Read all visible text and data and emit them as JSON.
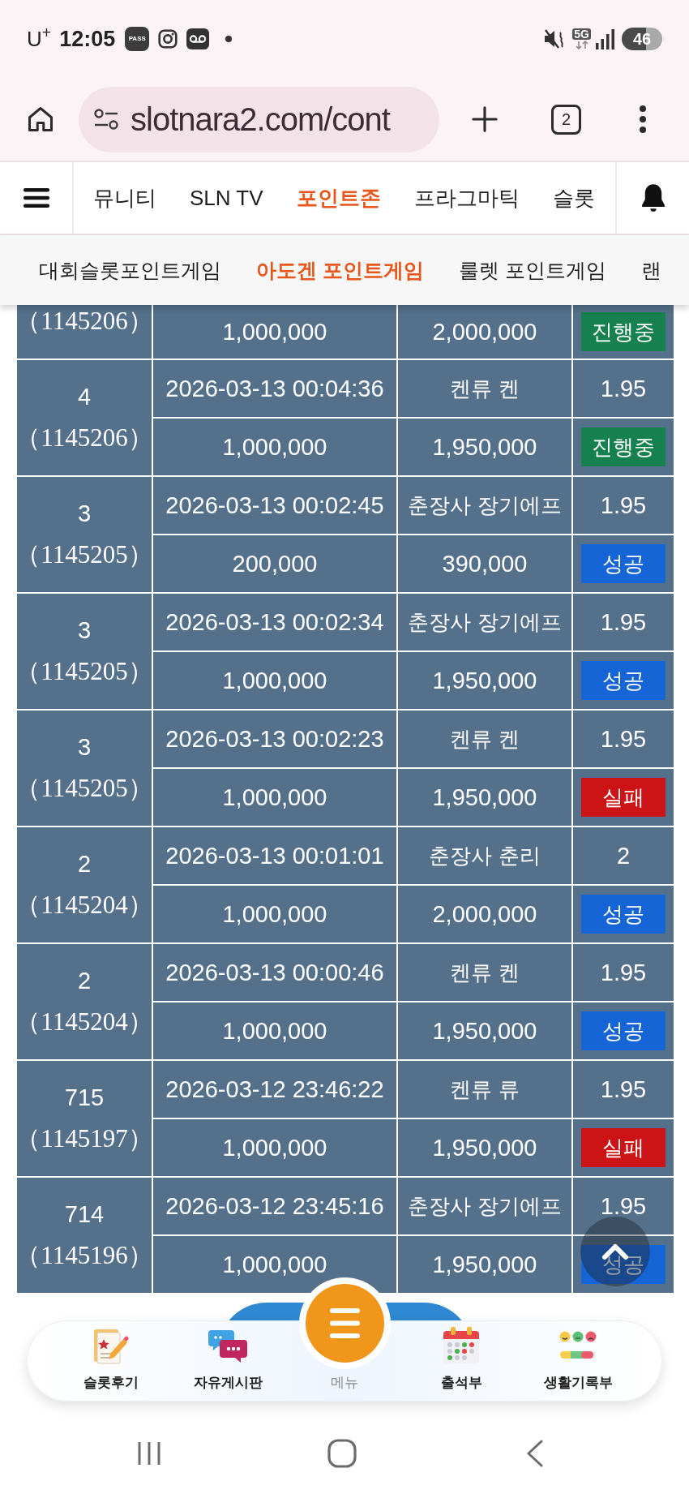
{
  "status_bar": {
    "carrier": "U$^{+}$",
    "time": "12:05",
    "app_badge": "PASS",
    "network": "5G",
    "battery": "46"
  },
  "browser": {
    "url": "slotnara2.com/cont",
    "tab_count": "2"
  },
  "main_nav": [
    {
      "label": "뮤니티",
      "selected": false
    },
    {
      "label": "SLN TV",
      "selected": false
    },
    {
      "label": "포인트존",
      "selected": true
    },
    {
      "label": "프라그마틱",
      "selected": false
    },
    {
      "label": "슬롯",
      "selected": false
    }
  ],
  "sub_nav": [
    {
      "label": "대회슬롯포인트게임",
      "selected": false
    },
    {
      "label": "아도겐 포인트게임",
      "selected": true
    },
    {
      "label": "룰렛 포인트게임",
      "selected": false
    },
    {
      "label": "랜",
      "selected": false
    }
  ],
  "table": {
    "rows": [
      {
        "game_id": "（1145206）",
        "bet": "1,000,000",
        "payout": "2,000,000",
        "status": {
          "label": "진행중",
          "color": "#16804e"
        }
      },
      {
        "round": "4",
        "game_id": "（1145206）",
        "time": "2026-03-13 00:04:36",
        "game": "켄류 켄",
        "odds": "1.95",
        "bet": "1,000,000",
        "payout": "1,950,000",
        "status": {
          "label": "진행중",
          "color": "#16804e"
        }
      },
      {
        "round": "3",
        "game_id": "（1145205）",
        "time": "2026-03-13 00:02:45",
        "game": "춘장사 장기에프",
        "odds": "1.95",
        "bet": "200,000",
        "payout": "390,000",
        "status": {
          "label": "성공",
          "color": "#1565d6"
        }
      },
      {
        "round": "3",
        "game_id": "（1145205）",
        "time": "2026-03-13 00:02:34",
        "game": "춘장사 장기에프",
        "odds": "1.95",
        "bet": "1,000,000",
        "payout": "1,950,000",
        "status": {
          "label": "성공",
          "color": "#1565d6"
        }
      },
      {
        "round": "3",
        "game_id": "（1145205）",
        "time": "2026-03-13 00:02:23",
        "game": "켄류 켄",
        "odds": "1.95",
        "bet": "1,000,000",
        "payout": "1,950,000",
        "status": {
          "label": "실패",
          "color": "#cc1417"
        }
      },
      {
        "round": "2",
        "game_id": "（1145204）",
        "time": "2026-03-13 00:01:01",
        "game": "춘장사 춘리",
        "odds": "2",
        "bet": "1,000,000",
        "payout": "2,000,000",
        "status": {
          "label": "성공",
          "color": "#1565d6"
        }
      },
      {
        "round": "2",
        "game_id": "（1145204）",
        "time": "2026-03-13 00:00:46",
        "game": "켄류 켄",
        "odds": "1.95",
        "bet": "1,000,000",
        "payout": "1,950,000",
        "status": {
          "label": "성공",
          "color": "#1565d6"
        }
      },
      {
        "round": "715",
        "game_id": "（1145197）",
        "time": "2026-03-12 23:46:22",
        "game": "켄류 류",
        "odds": "1.95",
        "bet": "1,000,000",
        "payout": "1,950,000",
        "status": {
          "label": "실패",
          "color": "#cc1417"
        }
      },
      {
        "round": "714",
        "game_id": "（1145196）",
        "time": "2026-03-12 23:45:16",
        "game": "춘장사 장기에프",
        "odds": "1.95",
        "bet": "1,000,000",
        "payout": "1,950,000",
        "status": {
          "label": "성공",
          "color": "#1565d6"
        }
      }
    ]
  },
  "bottom_nav": [
    {
      "label": "슬롯후기",
      "kind": "review"
    },
    {
      "label": "자유게시판",
      "kind": "board"
    },
    {
      "label": "메뉴",
      "kind": "menu"
    },
    {
      "label": "출석부",
      "kind": "attendance"
    },
    {
      "label": "생활기록부",
      "kind": "record"
    }
  ]
}
